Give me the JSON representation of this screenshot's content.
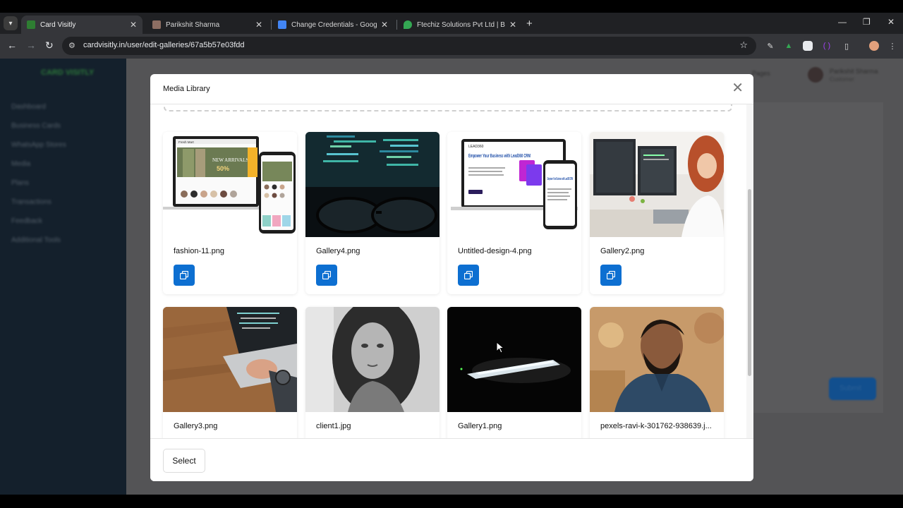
{
  "browser": {
    "tabs": [
      {
        "title": "Card Visitly",
        "favicon_color": "#2e7d32",
        "active": true
      },
      {
        "title": "Parikshit Sharma",
        "favicon_color": "#8d6e63",
        "active": false
      },
      {
        "title": "Change Credentials - Google Do",
        "favicon_color": "#4285f4",
        "active": false
      },
      {
        "title": "Ftechiz Solutions Pvt Ltd | Best",
        "favicon_color": "#34a853",
        "active": false
      }
    ],
    "url": "cardvisitly.in/user/edit-galleries/67a5b57e03fdd"
  },
  "background": {
    "sidebar_logo": "CARD VISITLY",
    "sidebar_items": [
      "Dashboard",
      "Business Cards",
      "WhatsApp Stores",
      "Media",
      "Plans",
      "Transactions",
      "Feedback",
      "Additional Tools"
    ],
    "user_name": "Parikshit Sharma",
    "user_role": "Customer",
    "header_link": "Pages",
    "submit_label": "Submit"
  },
  "modal": {
    "title": "Media Library",
    "footer_button": "Select",
    "items": [
      {
        "filename": "fashion-11.png"
      },
      {
        "filename": "Gallery4.png"
      },
      {
        "filename": "Untitled-design-4.png"
      },
      {
        "filename": "Gallery2.png"
      },
      {
        "filename": "Gallery3.png"
      },
      {
        "filename": "client1.jpg"
      },
      {
        "filename": "Gallery1.png"
      },
      {
        "filename": "pexels-ravi-k-301762-938639.j..."
      }
    ]
  },
  "thumbnail_text": {
    "fashion_brand": "Fresh Mart",
    "fashion_headline": "NEW ARRIVALS",
    "fashion_sale": "50%",
    "lead_logo": "LEAD360",
    "lead_headline": "Empower Your Business with Lead360 CRM",
    "lead_headline_phone": "Empower Your Business with Lead360 CRM"
  },
  "colors": {
    "accent": "#0d6fd1",
    "sidebar": "#14202c",
    "overlay": "#4d4d4f"
  }
}
